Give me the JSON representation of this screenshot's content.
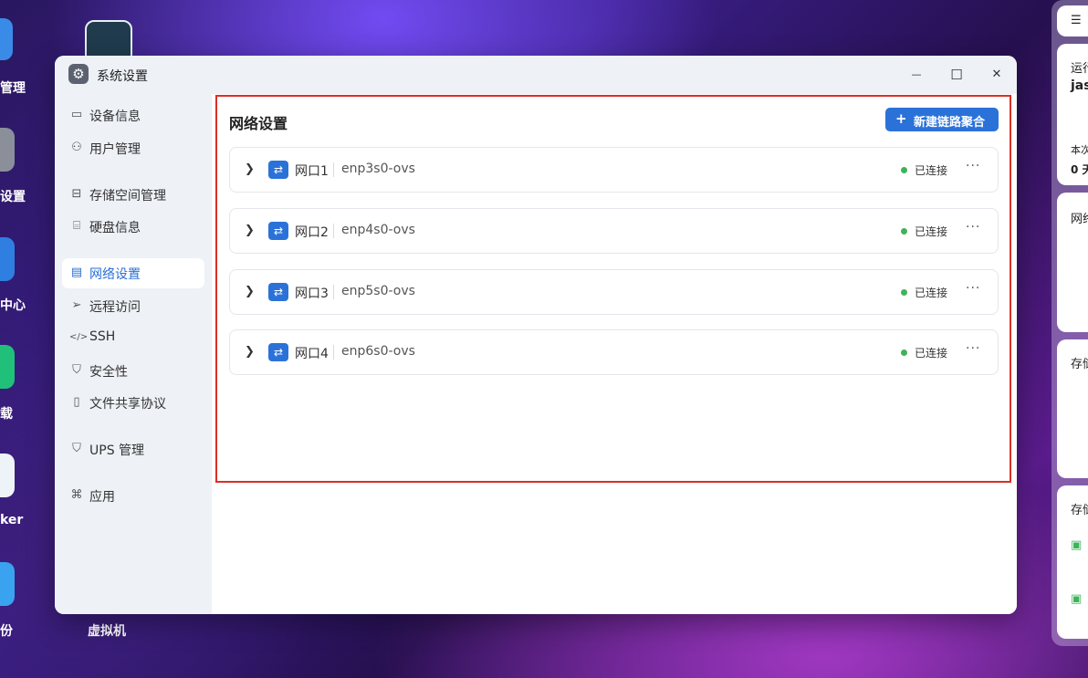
{
  "desktop": {
    "icons": [
      {
        "name": "storage-app-icon",
        "label": "管理"
      },
      {
        "name": "settings-app-icon",
        "label": "设置"
      },
      {
        "name": "center-app-icon",
        "label": "中心"
      },
      {
        "name": "app4-icon",
        "label": "载"
      },
      {
        "name": "docker-app-icon",
        "label": "ker"
      },
      {
        "name": "backup-app-icon",
        "label": "份"
      },
      {
        "name": "vm-app-icon",
        "label": "虚拟机"
      }
    ]
  },
  "right_panel": {
    "card1": {
      "title": "运行",
      "host": "jas",
      "uptime_label": "本次",
      "uptime_value": "0 天"
    },
    "card2": {
      "title": "网络"
    },
    "card3": {
      "title": "存储"
    },
    "card4": {
      "title": "存储"
    }
  },
  "window": {
    "title": "系统设置",
    "minimize_symbol": "—",
    "maximize_symbol": "☐",
    "close_symbol": "✕"
  },
  "sidebar": {
    "items": [
      {
        "label": "设备信息",
        "icon": "monitor-icon"
      },
      {
        "label": "用户管理",
        "icon": "user-icon"
      },
      {
        "label": "存储空间管理",
        "icon": "storage-icon"
      },
      {
        "label": "硬盘信息",
        "icon": "disk-icon"
      },
      {
        "label": "网络设置",
        "icon": "network-icon",
        "active": true
      },
      {
        "label": "远程访问",
        "icon": "send-icon"
      },
      {
        "label": "SSH",
        "icon": "code-icon"
      },
      {
        "label": "安全性",
        "icon": "shield-check-icon"
      },
      {
        "label": "文件共享协议",
        "icon": "document-icon"
      },
      {
        "label": "UPS 管理",
        "icon": "shield-icon"
      },
      {
        "label": "应用",
        "icon": "apps-icon"
      }
    ]
  },
  "main": {
    "title": "网络设置",
    "new_button_label": "新建链路聚合",
    "ports": [
      {
        "name": "网口1",
        "device": "enp3s0-ovs",
        "status": "已连接"
      },
      {
        "name": "网口2",
        "device": "enp4s0-ovs",
        "status": "已连接"
      },
      {
        "name": "网口3",
        "device": "enp5s0-ovs",
        "status": "已连接"
      },
      {
        "name": "网口4",
        "device": "enp6s0-ovs",
        "status": "已连接"
      }
    ]
  },
  "colors": {
    "accent": "#2b72d8",
    "status_ok": "#3db35a",
    "highlight": "#d93025"
  }
}
